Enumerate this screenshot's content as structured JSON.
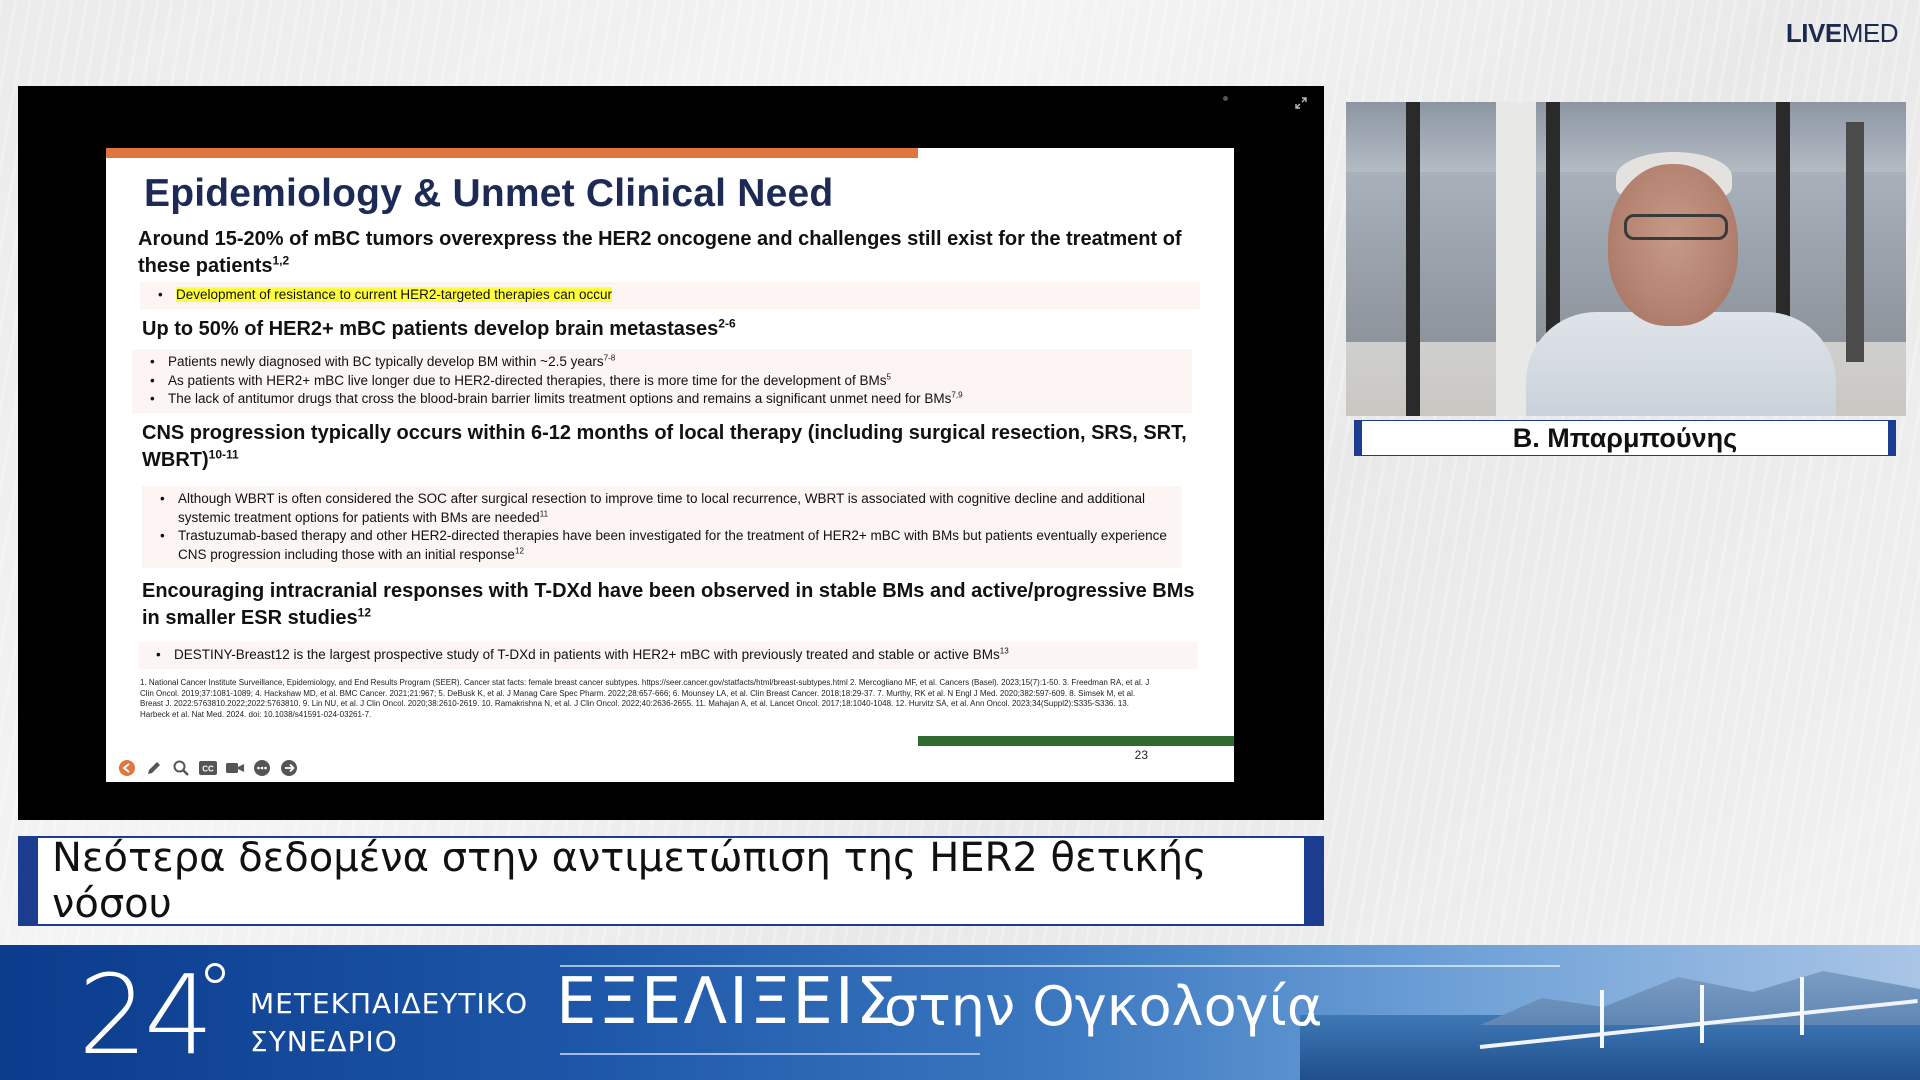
{
  "logo": {
    "brand_bold": "LIVE",
    "brand_light": "MED"
  },
  "slide": {
    "title": "Epidemiology & Unmet Clinical Need",
    "sections": [
      {
        "heading": "Around 15-20% of mBC tumors overexpress the HER2 oncogene and challenges still exist for the treatment of these patients",
        "sup": "1,2",
        "bullets": [
          {
            "text": "Development of resistance to current HER2-targeted therapies can occur",
            "sup": "",
            "highlight": true
          }
        ]
      },
      {
        "heading": "Up to 50% of HER2+ mBC patients develop brain metastases",
        "sup": "2-6",
        "bullets": [
          {
            "text": "Patients newly diagnosed with BC typically develop BM within ~2.5 years",
            "sup": "7-8"
          },
          {
            "text": "As patients with HER2+ mBC live longer due to HER2-directed therapies, there is more time for the development of BMs",
            "sup": "5"
          },
          {
            "text": "The lack of antitumor drugs that cross the blood-brain barrier limits treatment options and remains a significant unmet need for BMs",
            "sup": "7,9"
          }
        ]
      },
      {
        "heading": "CNS progression typically occurs within 6-12 months of local therapy (including surgical resection, SRS, SRT, WBRT)",
        "sup": "10-11",
        "bullets": [
          {
            "text": "Although WBRT is often considered the SOC after surgical resection to improve time to local recurrence, WBRT is associated with cognitive decline and additional systemic treatment options for patients with BMs are needed",
            "sup": "11"
          },
          {
            "text": "Trastuzumab-based therapy and other HER2-directed therapies have been investigated for the treatment of HER2+ mBC with BMs but patients eventually experience CNS progression including those with an initial response",
            "sup": "12"
          }
        ]
      },
      {
        "heading": "Encouraging intracranial responses with T-DXd have been observed in stable BMs and active/progressive BMs in smaller ESR studies",
        "sup": "12",
        "bullets": [
          {
            "text": "DESTINY-Breast12 is the largest prospective study of T-DXd in patients with HER2+ mBC with previously treated and stable or active BMs",
            "sup": "13"
          }
        ]
      }
    ],
    "references": "1. National Cancer Institute Surveillance, Epidemiology, and End Results Program (SEER). Cancer stat facts: female breast cancer subtypes. https://seer.cancer.gov/statfacts/html/breast-subtypes.html 2. Mercogliano MF, et al. Cancers (Basel). 2023;15(7):1-50. 3. Freedman RA, et al. J Clin Oncol. 2019;37:1081-1089; 4. Hackshaw MD, et al. BMC Cancer. 2021;21:967; 5. DeBusk K, et al. J Manag Care Spec Pharm. 2022;28:657-666; 6. Mounsey LA, et al. Clin Breast Cancer. 2018;18:29-37. 7. Murthy, RK et al. N Engl J Med. 2020;382:597-609. 8. Simsek M, et al. Breast J. 2022:5763810.2022;2022:5763810. 9. Lin NU, et al. J Clin Oncol. 2020;38:2610-2619. 10. Ramakrishna N, et al. J Clin Oncol. 2022;40:2636-2655. 11. Mahajan A, et al. Lancet Oncol. 2017;18:1040-1048. 12. Hurvitz SA, et al. Ann Oncol. 2023;34(Suppl2):S335-S336. 13. Harbeck et al. Nat Med. 2024. doi: 10.1038/s41591-024-03261-7.",
    "page_number": "23"
  },
  "toolbar": {
    "icons": [
      "back-icon",
      "pen-icon",
      "zoom-icon",
      "captions-icon",
      "camera-icon",
      "more-icon",
      "forward-icon"
    ]
  },
  "speaker": {
    "name": "Β. Μπαρμπούνης"
  },
  "talk_title": "Νεότερα δεδομένα στην αντιμετώπιση της HER2 θετικής νόσου",
  "banner": {
    "number": "24",
    "line1": "ΜΕΤΕΚΠΑΙΔΕΥΤΙΚΟ",
    "line2": "ΣΥΝΕΔΡΙΟ",
    "headline1": "ΕΞΕΛΙΞΕΙΣ",
    "headline2": "στην Ογκολογία"
  },
  "colors": {
    "brand_blue": "#1c3d8f",
    "slide_title": "#1c2a55",
    "accent_orange": "#e0763d",
    "accent_green": "#2f6b2f",
    "highlight": "#ffff40"
  }
}
